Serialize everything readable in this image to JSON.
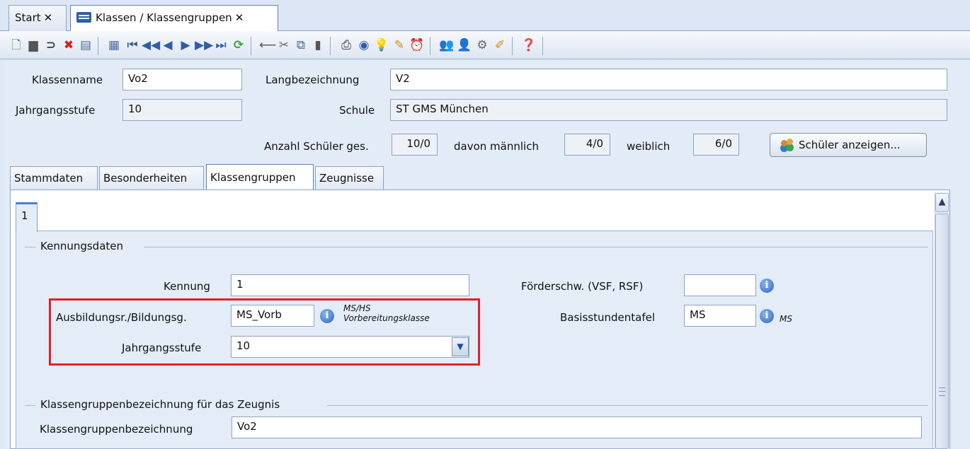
{
  "doc_tabs": [
    {
      "label": "Start",
      "close": "✕"
    },
    {
      "label": "Klassen / Klassengruppen",
      "close": "✕"
    }
  ],
  "toolbar": {
    "icons": [
      "new-icon",
      "save-icon",
      "undo-icon",
      "delete-icon",
      "list-icon",
      "grid-icon",
      "first-icon",
      "prev-page-icon",
      "prev-icon",
      "next-icon",
      "next-page-icon",
      "last-icon",
      "refresh-icon",
      "back-icon",
      "cut-icon",
      "copy-icon",
      "paste-icon",
      "print-icon",
      "preview-icon",
      "tips-icon",
      "clean-icon",
      "alarm-icon",
      "users-icon",
      "user-icon",
      "settings-icon",
      "edit-icon",
      "help-icon"
    ]
  },
  "header": {
    "klassenname_label": "Klassenname",
    "klassenname_value": "Vo2",
    "langbezeichnung_label": "Langbezeichnung",
    "langbezeichnung_value": "V2",
    "jahrgangsstufe_label": "Jahrgangsstufe",
    "jahrgangsstufe_value": "10",
    "schule_label": "Schule",
    "schule_value": "ST GMS München",
    "anzahl_label": "Anzahl Schüler ges.",
    "anzahl_value": "10/0",
    "maennlich_label": "davon männlich",
    "maennlich_value": "4/0",
    "weiblich_label": "weiblich",
    "weiblich_value": "6/0",
    "show_students_button": "Schüler anzeigen..."
  },
  "section_tabs": [
    "Stammdaten",
    "Besonderheiten",
    "Klassengruppen",
    "Zeugnisse"
  ],
  "subtab_label": "1",
  "kennungsdaten": {
    "group_title": "Kennungsdaten",
    "kennung_label": "Kennung",
    "kennung_value": "1",
    "foerder_label": "Förderschw. (VSF, RSF)",
    "foerder_value": "",
    "ausbildung_label": "Ausbildungsr./Bildungsg.",
    "ausbildung_value": "MS_Vorb",
    "ausbildung_note_line1": "MS/HS",
    "ausbildung_note_line2": "Vorbereitungsklasse",
    "basis_label": "Basisstundentafel",
    "basis_value": "MS",
    "basis_note": "MS",
    "jahrgang_label": "Jahrgangsstufe",
    "jahrgang_value": "10"
  },
  "zeugnis": {
    "group_title": "Klassengruppenbezeichnung für das Zeugnis",
    "label": "Klassengruppenbezeichnung",
    "value": "Vo2"
  },
  "colors": {
    "highlight_border": "#e0202c",
    "accent": "#2f5ea3"
  }
}
